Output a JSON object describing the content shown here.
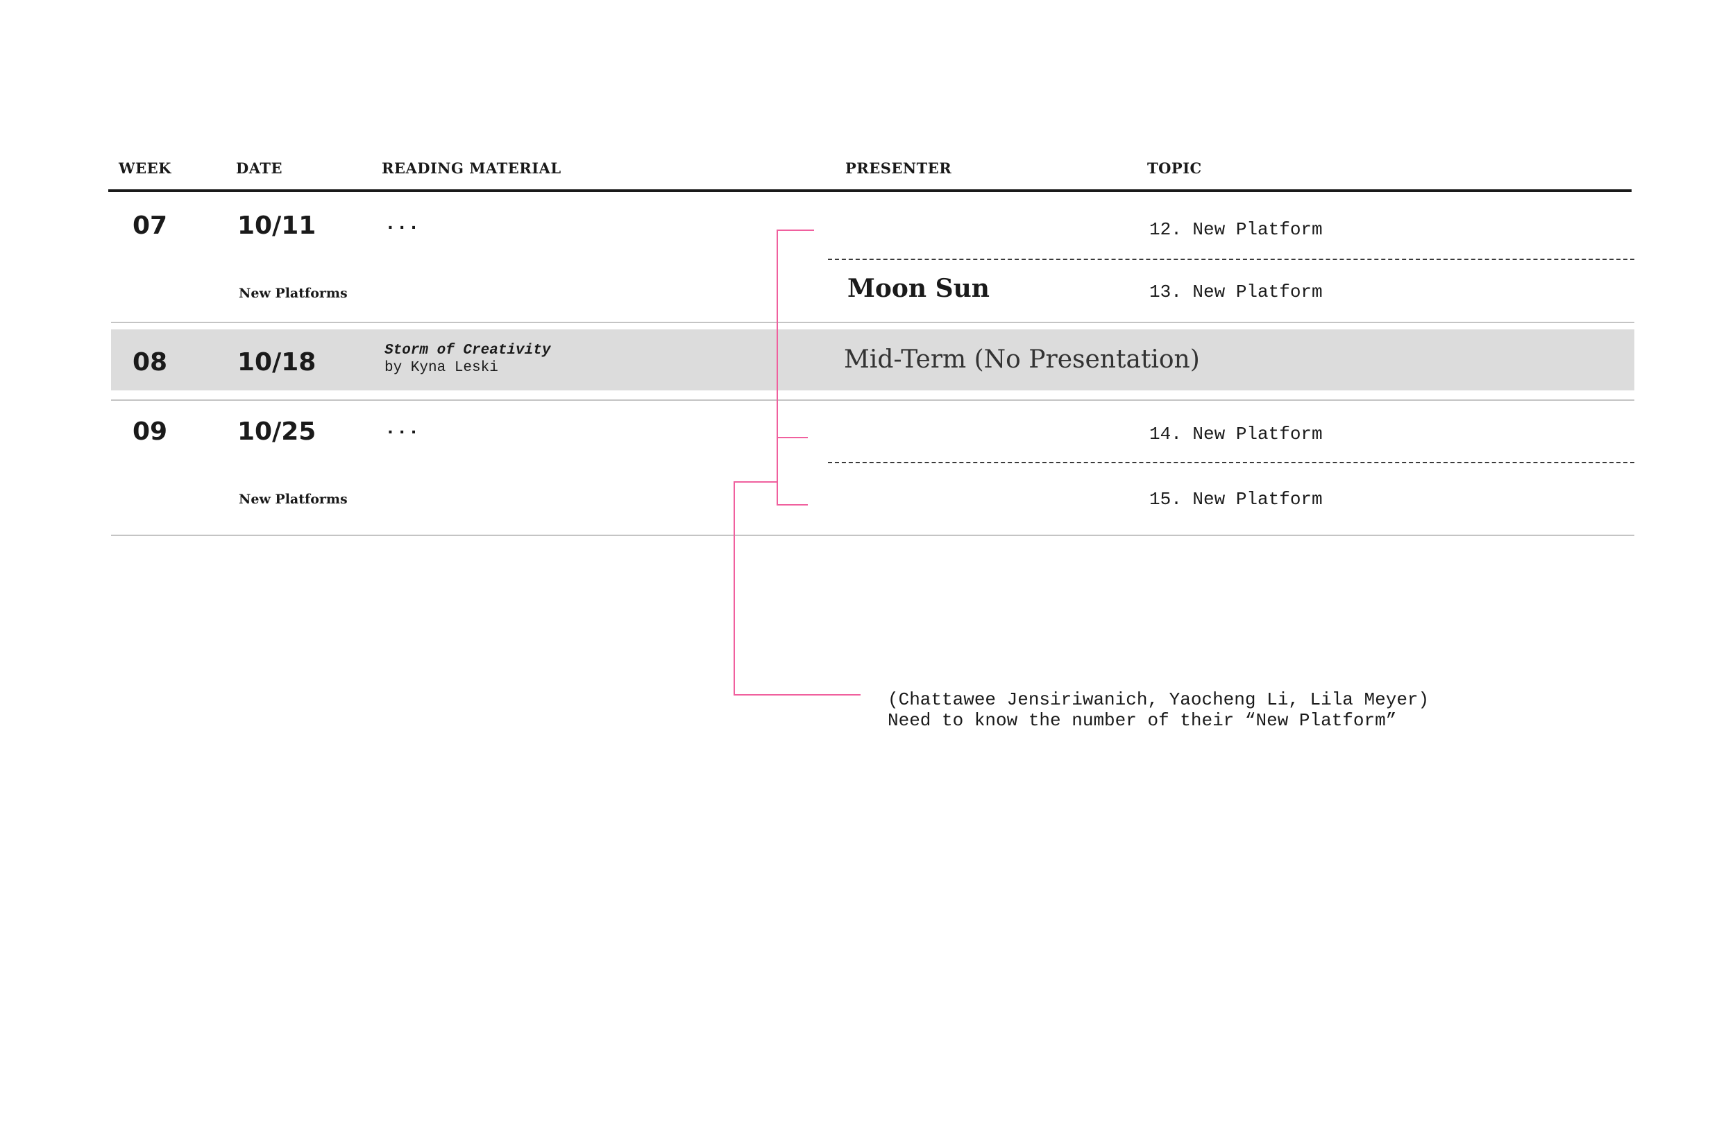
{
  "header": {
    "week": "WEEK",
    "date": "DATE",
    "reading": "READING MATERIAL",
    "presenter": "PRESENTER",
    "topic": "TOPIC"
  },
  "rows": [
    {
      "week": "07",
      "date": "10/11",
      "sublabel": "New Platforms",
      "reading": "...",
      "presenter": "Moon Sun",
      "topics": [
        "12. New Platform",
        "13. New Platform"
      ]
    },
    {
      "week": "08",
      "date": "10/18",
      "reading_title": "Storm of Creativity",
      "reading_author": "by Kyna Leski",
      "midterm": "Mid-Term (No Presentation)"
    },
    {
      "week": "09",
      "date": "10/25",
      "sublabel": "New Platforms",
      "reading": "...",
      "topics": [
        "14. New Platform",
        "15. New Platform"
      ]
    }
  ],
  "annotation": {
    "line1": "(Chattawee Jensiriwanich, Yaocheng Li, Lila Meyer)",
    "line2": "Need to know the number of their “New Platform”",
    "color": "#f0609e"
  }
}
